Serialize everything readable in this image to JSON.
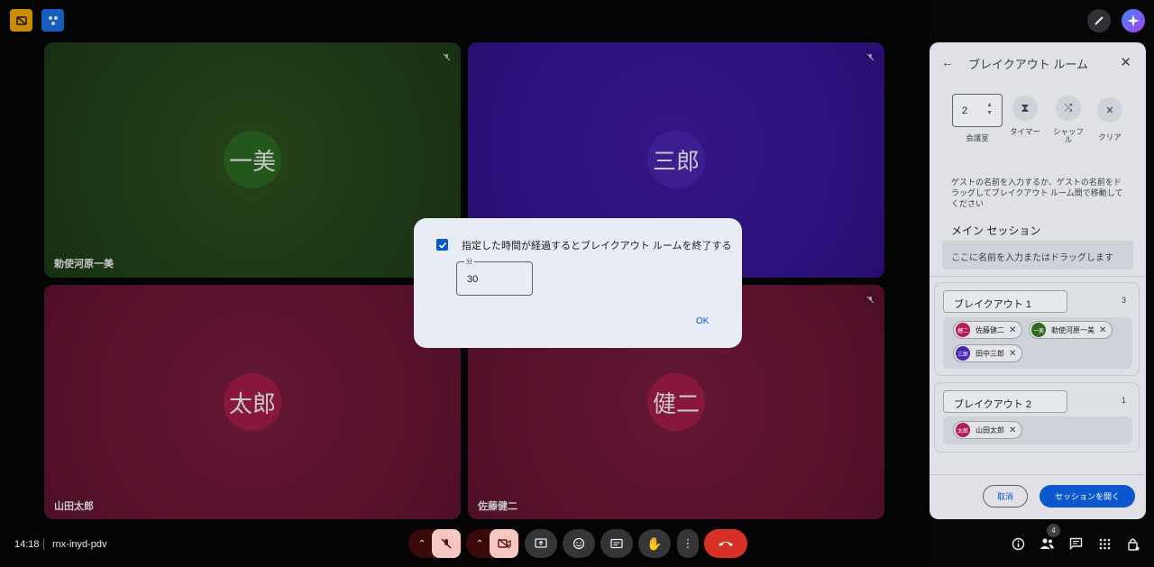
{
  "tiles": [
    {
      "initials": "一美",
      "name": "勅使河原一美"
    },
    {
      "initials": "三郎",
      "name": ""
    },
    {
      "initials": "太郎",
      "name": "山田太郎"
    },
    {
      "initials": "健二",
      "name": "佐藤健二"
    }
  ],
  "panel": {
    "title": "ブレイクアウト ルーム",
    "room_count_value": "2",
    "room_count_label": "会議室",
    "timer_label": "タイマー",
    "shuffle_label": "シャッフル",
    "clear_label": "クリア",
    "instruction": "ゲストの名前を入力するか、ゲストの名前をドラッグしてブレイクアウト ルーム間で移動してください",
    "main_session_title": "メイン セッション",
    "main_session_placeholder": "ここに名前を入力またはドラッグします",
    "rooms": [
      {
        "name": "ブレイクアウト 1",
        "count": "3",
        "members": [
          {
            "initials": "健二",
            "name": "佐藤健二"
          },
          {
            "initials": "一美",
            "name": "勅使河原一美"
          },
          {
            "initials": "三郎",
            "name": "田中三郎"
          }
        ]
      },
      {
        "name": "ブレイクアウト 2",
        "count": "1",
        "members": [
          {
            "initials": "太郎",
            "name": "山田太郎"
          }
        ]
      }
    ],
    "cancel_label": "取消",
    "open_label": "セッションを開く"
  },
  "dialog": {
    "checkbox_label": "指定した時間が経過するとブレイクアウト ルームを終了する",
    "minutes_label": "分",
    "minutes_value": "30",
    "ok_label": "OK"
  },
  "bottom": {
    "time": "14:18",
    "meeting_code": "rnx-inyd-pdv",
    "people_badge": "4"
  },
  "colors": {
    "green_tile": "#2a4a1c",
    "purple_tile": "#3a1a8a",
    "crimson_tile": "#6e1535",
    "accent_blue": "#0b57d0",
    "end_call_red": "#d93025"
  }
}
